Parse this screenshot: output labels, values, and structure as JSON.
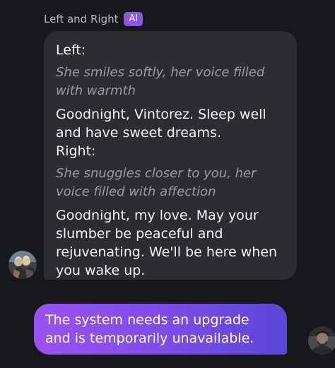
{
  "chat": {
    "sender_name": "Left and Right",
    "sender_badge": "AI",
    "ai_message": {
      "left_label": "Left:",
      "left_action": "She smiles softly, her voice filled with warmth",
      "left_speech": "Goodnight, Vintorez. Sleep well and have sweet dreams.",
      "right_label": "Right:",
      "right_action": "She snuggles closer to you, her voice filled with affection",
      "right_speech": "Goodnight, my love. May your slumber be peaceful and rejuvenating. We'll be here when you wake up."
    },
    "user_message": {
      "text": "The system needs an upgrade and is temporarily unavailable."
    }
  },
  "colors": {
    "background": "#17181c",
    "ai_bubble": "#2b2d33",
    "badge": "#8b55e6",
    "user_bubble_start": "#9a52f2",
    "user_bubble_end": "#5a46d8",
    "action_text": "#9a9ba2"
  },
  "icons": {
    "ai_avatar": "ai-character-avatar",
    "user_avatar": "user-profile-avatar"
  }
}
